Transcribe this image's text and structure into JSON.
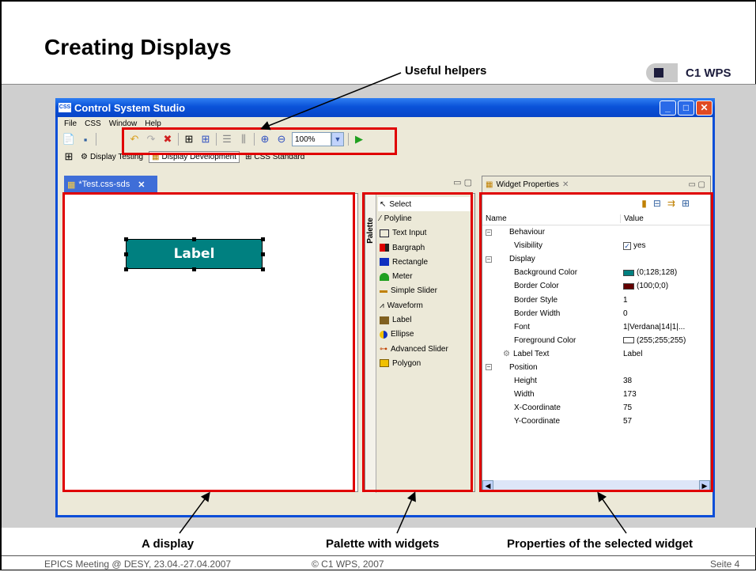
{
  "slide": {
    "title": "Creating Displays",
    "logo_text": "C1 WPS",
    "callouts": {
      "useful_helpers": "Useful helpers",
      "a_display": "A display",
      "palette": "Palette with widgets",
      "properties": "Properties of the selected widget"
    },
    "footer": {
      "left": "EPICS Meeting @ DESY, 23.04.-27.04.2007",
      "center": "© C1 WPS, 2007",
      "right": "Seite 4"
    }
  },
  "window": {
    "title": "Control System Studio",
    "title_icon": "CSS",
    "menu": [
      "File",
      "CSS",
      "Window",
      "Help"
    ],
    "zoom": "100%",
    "perspectives": [
      "Display Testing",
      "Display Development",
      "CSS Standard"
    ],
    "editor_tab": "*Test.css-sds"
  },
  "display": {
    "label_text": "Label",
    "label_bg": "#008080"
  },
  "palette": {
    "title": "Palette",
    "items": [
      "Select",
      "Polyline",
      "Text Input",
      "Bargraph",
      "Rectangle",
      "Meter",
      "Simple Slider",
      "Waveform",
      "Label",
      "Ellipse",
      "Advanced Slider",
      "Polygon"
    ]
  },
  "properties": {
    "tab": "Widget Properties",
    "col_name": "Name",
    "col_value": "Value",
    "rows": [
      {
        "name": "Behaviour",
        "value": "",
        "group": true
      },
      {
        "name": "Visibility",
        "value": "yes",
        "check": true
      },
      {
        "name": "Display",
        "value": "",
        "group": true
      },
      {
        "name": "Background Color",
        "value": "(0;128;128)",
        "swatch": "#008080"
      },
      {
        "name": "Border Color",
        "value": "(100;0;0)",
        "swatch": "#640000"
      },
      {
        "name": "Border Style",
        "value": "1"
      },
      {
        "name": "Border Width",
        "value": "0"
      },
      {
        "name": "Font",
        "value": "1|Verdana|14|1|..."
      },
      {
        "name": "Foreground Color",
        "value": "(255;255;255)",
        "swatch": "#ffffff"
      },
      {
        "name": "Label Text",
        "value": "Label"
      },
      {
        "name": "Position",
        "value": "",
        "group": true
      },
      {
        "name": "Height",
        "value": "38"
      },
      {
        "name": "Width",
        "value": "173"
      },
      {
        "name": "X-Coordinate",
        "value": "75"
      },
      {
        "name": "Y-Coordinate",
        "value": "57"
      }
    ]
  },
  "colors": {
    "highlight": "#e00000",
    "titlebar": "#0a52d8"
  }
}
